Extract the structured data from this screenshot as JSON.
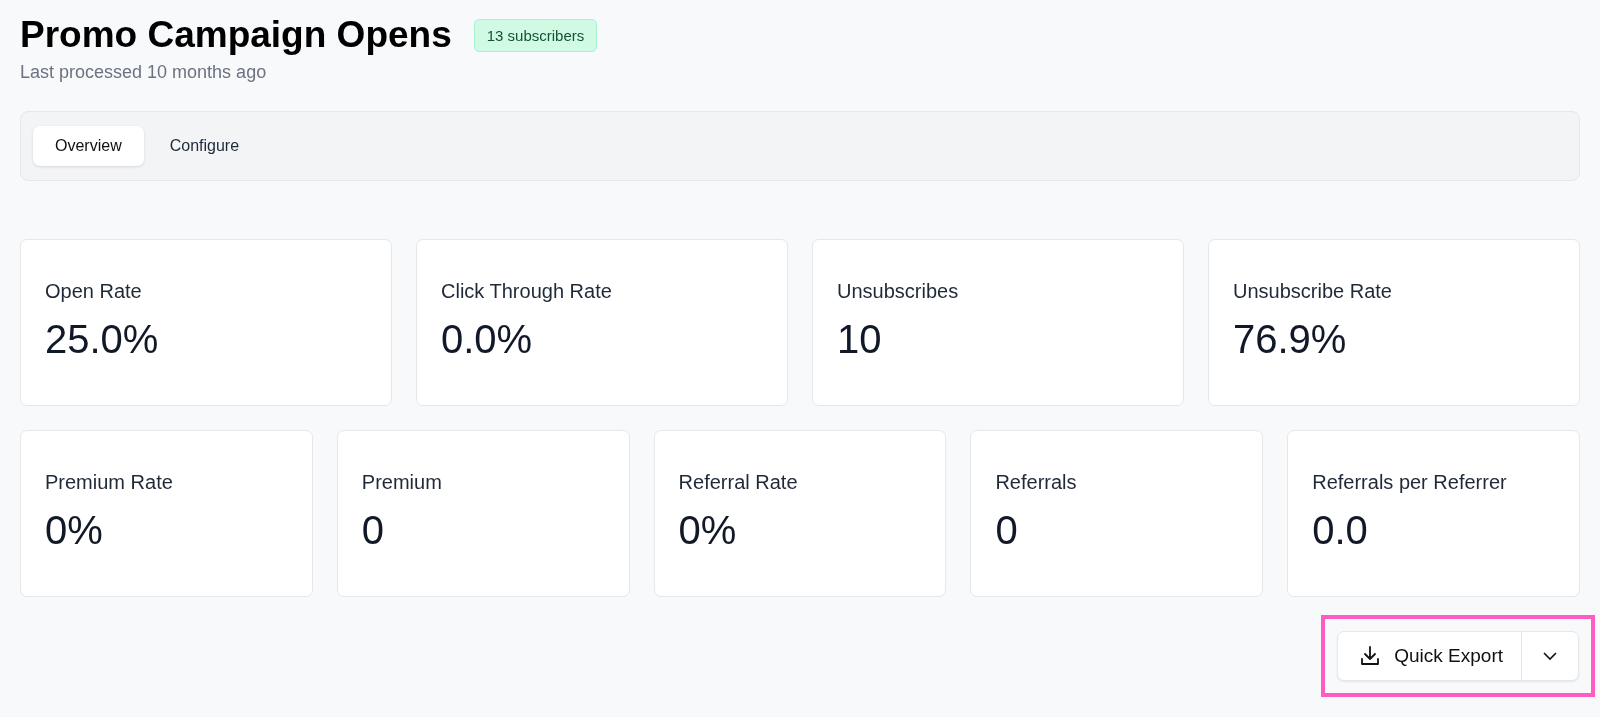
{
  "header": {
    "title": "Promo Campaign Opens",
    "badge": "13 subscribers",
    "subtitle": "Last processed 10 months ago"
  },
  "tabs": [
    {
      "label": "Overview",
      "selected": true
    },
    {
      "label": "Configure",
      "selected": false
    }
  ],
  "stat_rows": [
    [
      {
        "label": "Open Rate",
        "value": "25.0%"
      },
      {
        "label": "Click Through Rate",
        "value": "0.0%"
      },
      {
        "label": "Unsubscribes",
        "value": "10"
      },
      {
        "label": "Unsubscribe Rate",
        "value": "76.9%"
      }
    ],
    [
      {
        "label": "Premium Rate",
        "value": "0%"
      },
      {
        "label": "Premium",
        "value": "0"
      },
      {
        "label": "Referral Rate",
        "value": "0%"
      },
      {
        "label": "Referrals",
        "value": "0"
      },
      {
        "label": "Referrals per Referrer",
        "value": "0.0"
      }
    ]
  ],
  "export": {
    "label": "Quick Export",
    "highlighted": true
  }
}
